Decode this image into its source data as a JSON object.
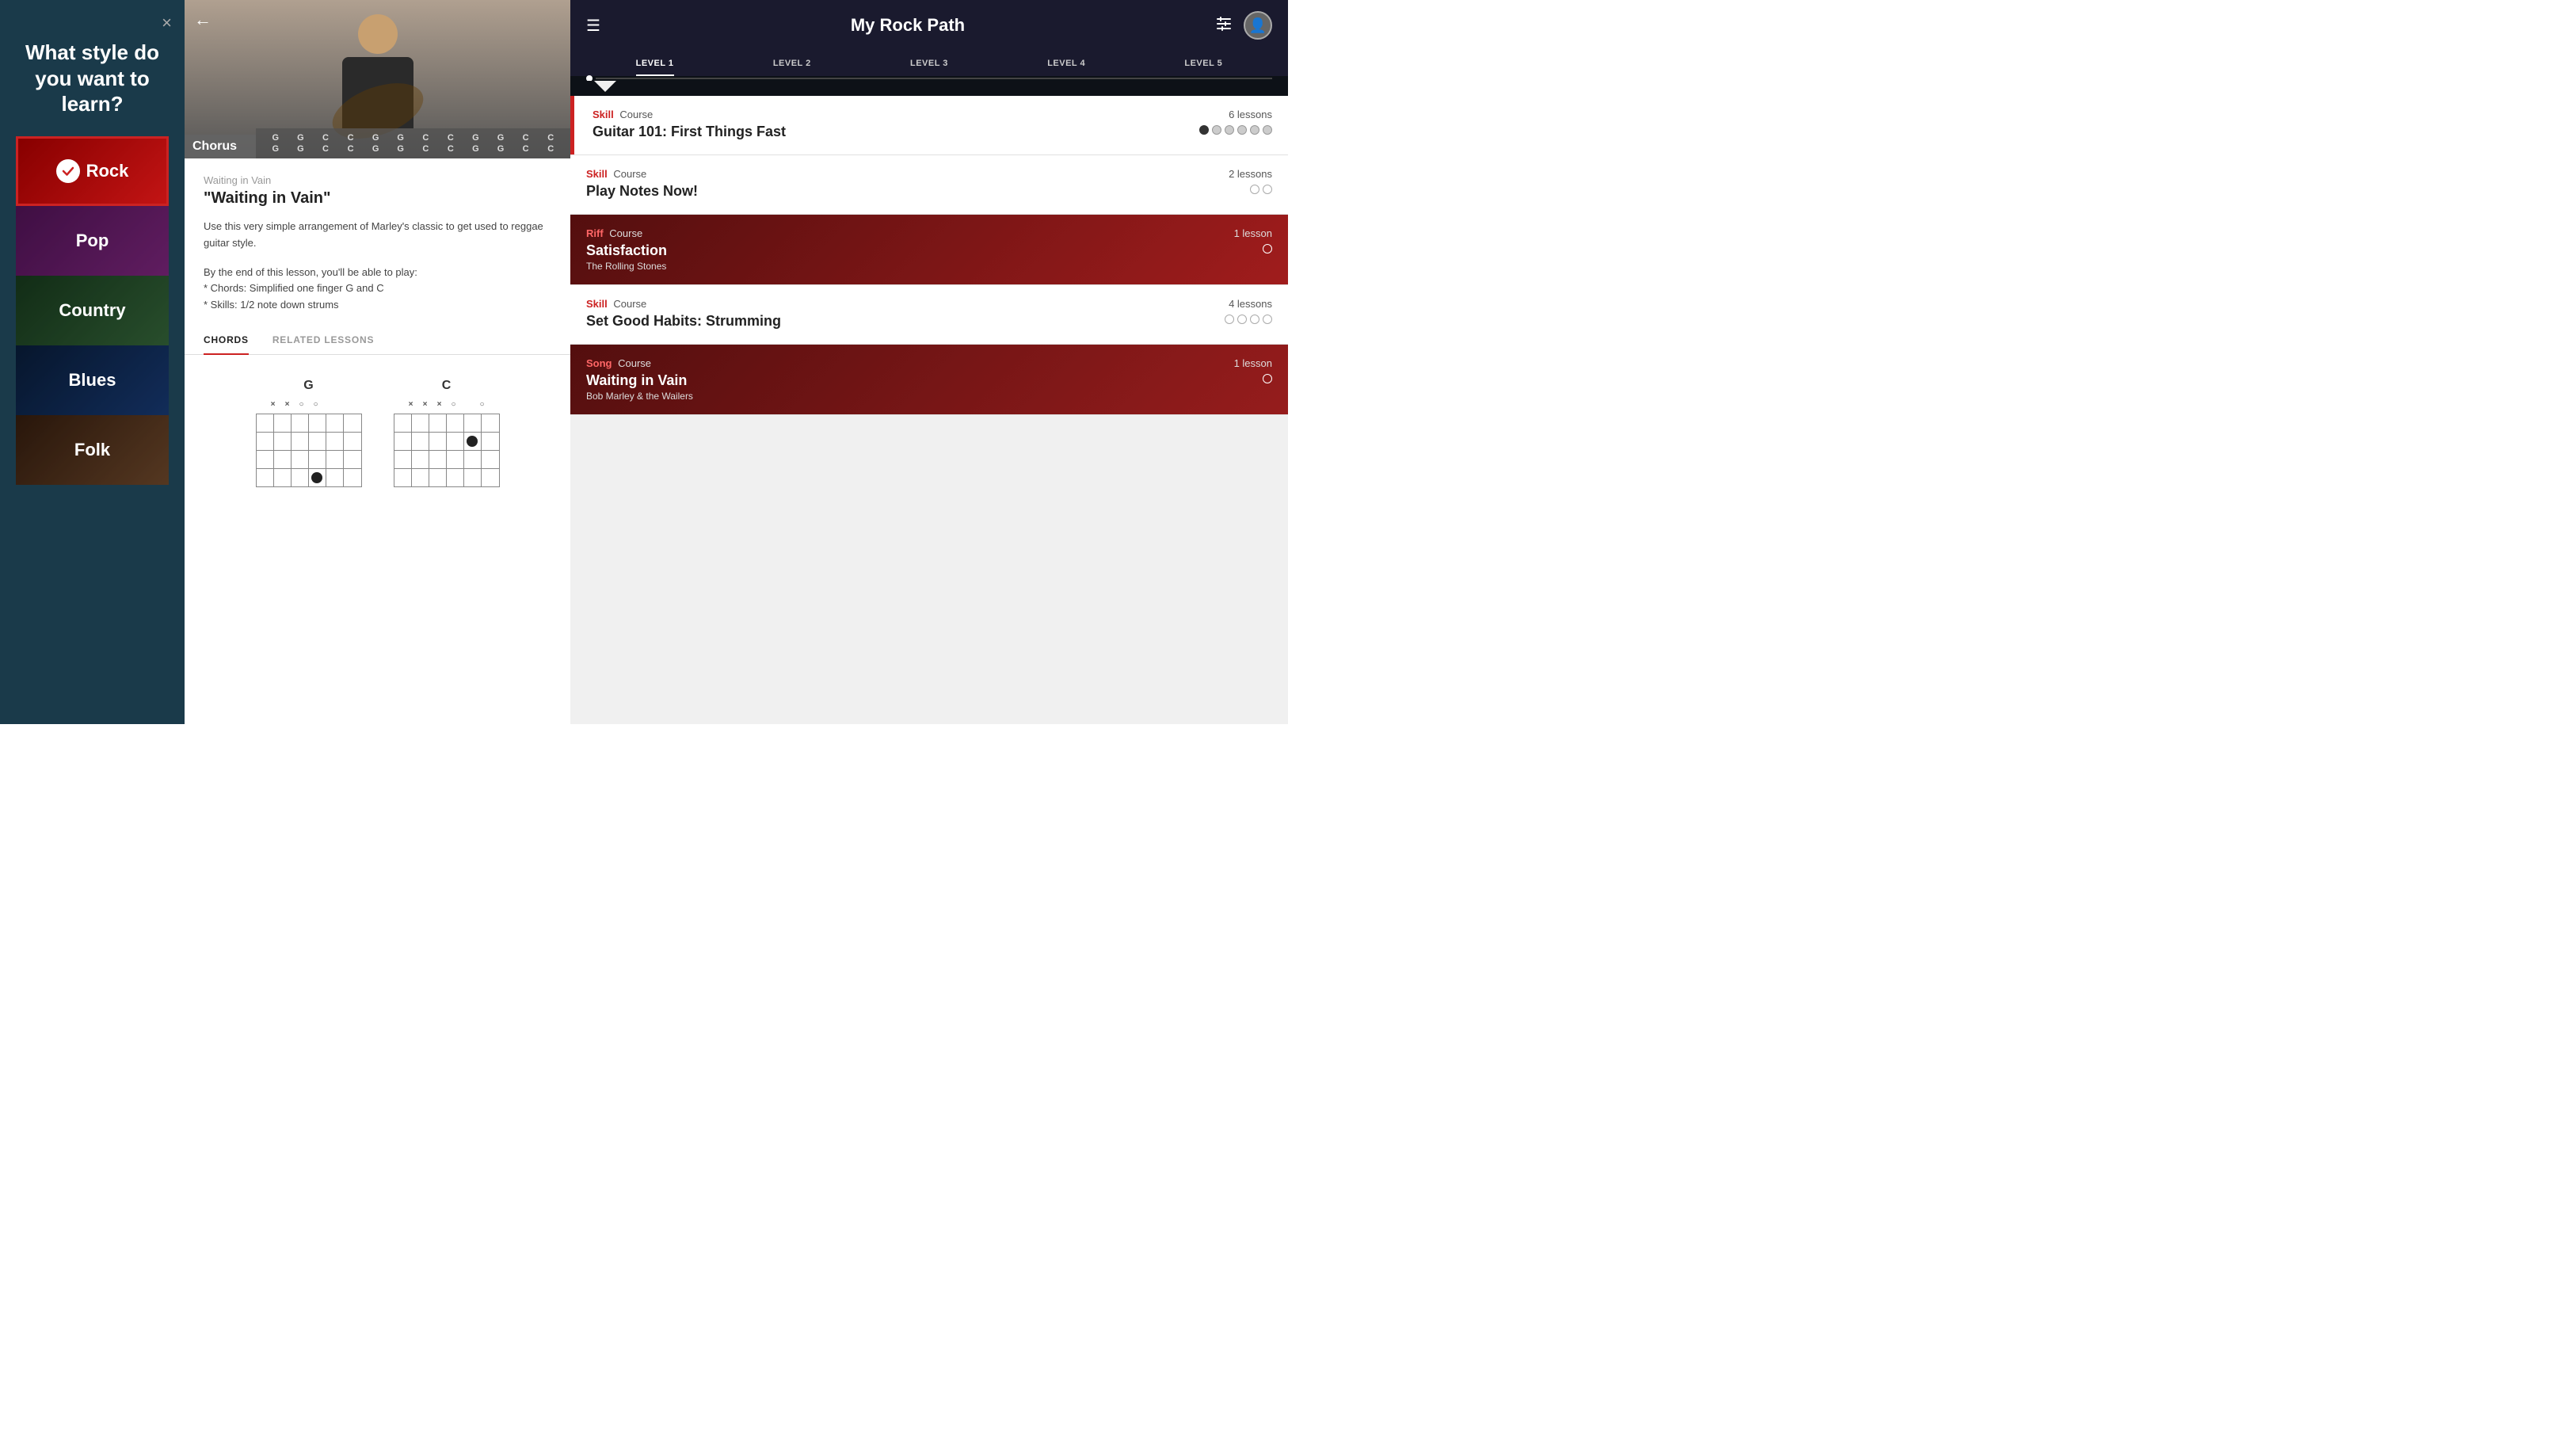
{
  "left": {
    "title": "What style do you want to learn?",
    "close_label": "×",
    "styles": [
      {
        "id": "rock",
        "label": "Rock",
        "selected": true
      },
      {
        "id": "pop",
        "label": "Pop",
        "selected": false
      },
      {
        "id": "country",
        "label": "Country",
        "selected": false
      },
      {
        "id": "blues",
        "label": "Blues",
        "selected": false
      },
      {
        "id": "folk",
        "label": "Folk",
        "selected": false
      }
    ]
  },
  "middle": {
    "back_label": "←",
    "chord_section_label": "Chorus",
    "chord_grid": [
      "G",
      "G",
      "C",
      "C",
      "G",
      "G",
      "C",
      "C",
      "G",
      "G",
      "C",
      "C",
      "G",
      "G",
      "C",
      "C",
      "G",
      "G",
      "C",
      "C",
      "G",
      "G",
      "C",
      "C"
    ],
    "lesson_subtitle": "Waiting in Vain",
    "lesson_title": "\"Waiting in Vain\"",
    "lesson_desc1": "Use this very simple arrangement of Marley's classic to get used to reggae guitar style.",
    "lesson_desc2": "By the end of this lesson, you'll be able to play:\n* Chords: Simplified one finger G and C\n* Skills: 1/2 note down strums",
    "tabs": [
      {
        "id": "chords",
        "label": "CHORDS",
        "active": true
      },
      {
        "id": "related",
        "label": "RELATED LESSONS",
        "active": false
      }
    ],
    "chords": [
      {
        "name": "G",
        "top_markers": [
          "×",
          "×",
          "○",
          "○",
          "",
          ""
        ],
        "frets": [
          [
            false,
            false,
            false,
            false,
            false,
            false
          ],
          [
            false,
            false,
            false,
            false,
            false,
            false
          ],
          [
            false,
            false,
            false,
            false,
            false,
            false
          ],
          [
            false,
            false,
            false,
            true,
            false,
            false
          ]
        ]
      },
      {
        "name": "C",
        "top_markers": [
          "×",
          "×",
          "×",
          "○",
          "",
          "○"
        ],
        "frets": [
          [
            false,
            false,
            false,
            false,
            false,
            false
          ],
          [
            false,
            false,
            false,
            false,
            true,
            false
          ],
          [
            false,
            false,
            false,
            false,
            false,
            false
          ],
          [
            false,
            false,
            false,
            false,
            false,
            false
          ]
        ]
      }
    ]
  },
  "right": {
    "header": {
      "menu_label": "☰",
      "title": "My Rock Path",
      "filter_label": "⚙",
      "profile_label": "👤"
    },
    "levels": [
      {
        "id": "level1",
        "label": "LEVEL 1",
        "active": true
      },
      {
        "id": "level2",
        "label": "LEVEL 2",
        "active": false
      },
      {
        "id": "level3",
        "label": "LEVEL 3",
        "active": false
      },
      {
        "id": "level4",
        "label": "LEVEL 4",
        "active": false
      },
      {
        "id": "level5",
        "label": "LEVEL 5",
        "active": false
      }
    ],
    "courses": [
      {
        "id": "guitar101",
        "type_bold": "Skill",
        "type_normal": "Course",
        "name": "Guitar 101: First Things Fast",
        "sub": "",
        "lessons_count": "6 lessons",
        "progress_dots": [
          1,
          0,
          0,
          0,
          0,
          0
        ],
        "dark": false,
        "has_left_bar": true
      },
      {
        "id": "playnotes",
        "type_bold": "Skill",
        "type_normal": "Course",
        "name": "Play Notes Now!",
        "sub": "",
        "lessons_count": "2 lessons",
        "progress_dots": [
          0,
          0
        ],
        "dark": false,
        "has_left_bar": false
      },
      {
        "id": "satisfaction",
        "type_bold": "Riff",
        "type_normal": "Course",
        "name": "Satisfaction",
        "sub": "The Rolling Stones",
        "lessons_count": "1 lesson",
        "progress_dots": [
          0
        ],
        "dark": true,
        "has_left_bar": false
      },
      {
        "id": "goodhabits",
        "type_bold": "Skill",
        "type_normal": "Course",
        "name": "Set Good Habits: Strumming",
        "sub": "",
        "lessons_count": "4 lessons",
        "progress_dots": [
          0,
          0,
          0,
          0
        ],
        "dark": false,
        "has_left_bar": false
      },
      {
        "id": "waitinginvain",
        "type_bold": "Song",
        "type_normal": "Course",
        "name": "Waiting in Vain",
        "sub": "Bob Marley & the Wailers",
        "lessons_count": "1 lesson",
        "progress_dots": [
          0
        ],
        "dark": true,
        "has_left_bar": false
      }
    ]
  }
}
